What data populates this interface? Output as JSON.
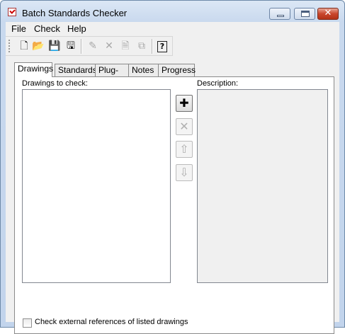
{
  "window": {
    "title": "Batch Standards Checker",
    "icon": "checklist-icon",
    "controls": {
      "minimize": "minimize-icon",
      "maximize": "maximize-icon",
      "close": "✕"
    }
  },
  "menu": {
    "items": [
      "File",
      "Check",
      "Help"
    ]
  },
  "toolbar": {
    "buttons": [
      {
        "icon": "new-file-icon",
        "glyph": "🗋",
        "enabled": true
      },
      {
        "icon": "open-folder-icon",
        "glyph": "📂",
        "enabled": true
      },
      {
        "icon": "save-icon",
        "glyph": "💾",
        "enabled": true
      },
      {
        "icon": "save-as-icon",
        "glyph": "🖫",
        "enabled": true
      },
      {
        "icon": "add-drawing-icon",
        "glyph": "✎",
        "enabled": false
      },
      {
        "icon": "remove-icon",
        "glyph": "✕",
        "enabled": false
      },
      {
        "icon": "document-icon",
        "glyph": "🗎",
        "enabled": false
      },
      {
        "icon": "copy-icon",
        "glyph": "⧉",
        "enabled": false
      },
      {
        "icon": "help-icon",
        "glyph": "?",
        "enabled": true
      }
    ]
  },
  "tabs": [
    "Drawings",
    "Standards",
    "Plug-ins",
    "Notes",
    "Progress"
  ],
  "active_tab": "Drawings",
  "drawings_panel": {
    "list_label": "Drawings to check:",
    "description_label": "Description:",
    "side_buttons": [
      {
        "icon": "add-icon",
        "glyph": "✚",
        "enabled": true
      },
      {
        "icon": "delete-icon",
        "glyph": "✕",
        "enabled": false
      },
      {
        "icon": "move-up-icon",
        "glyph": "⇧",
        "enabled": false
      },
      {
        "icon": "move-down-icon",
        "glyph": "⇩",
        "enabled": false
      }
    ],
    "external_refs_checkbox": {
      "label": "Check external references of listed drawings",
      "checked": false
    }
  }
}
